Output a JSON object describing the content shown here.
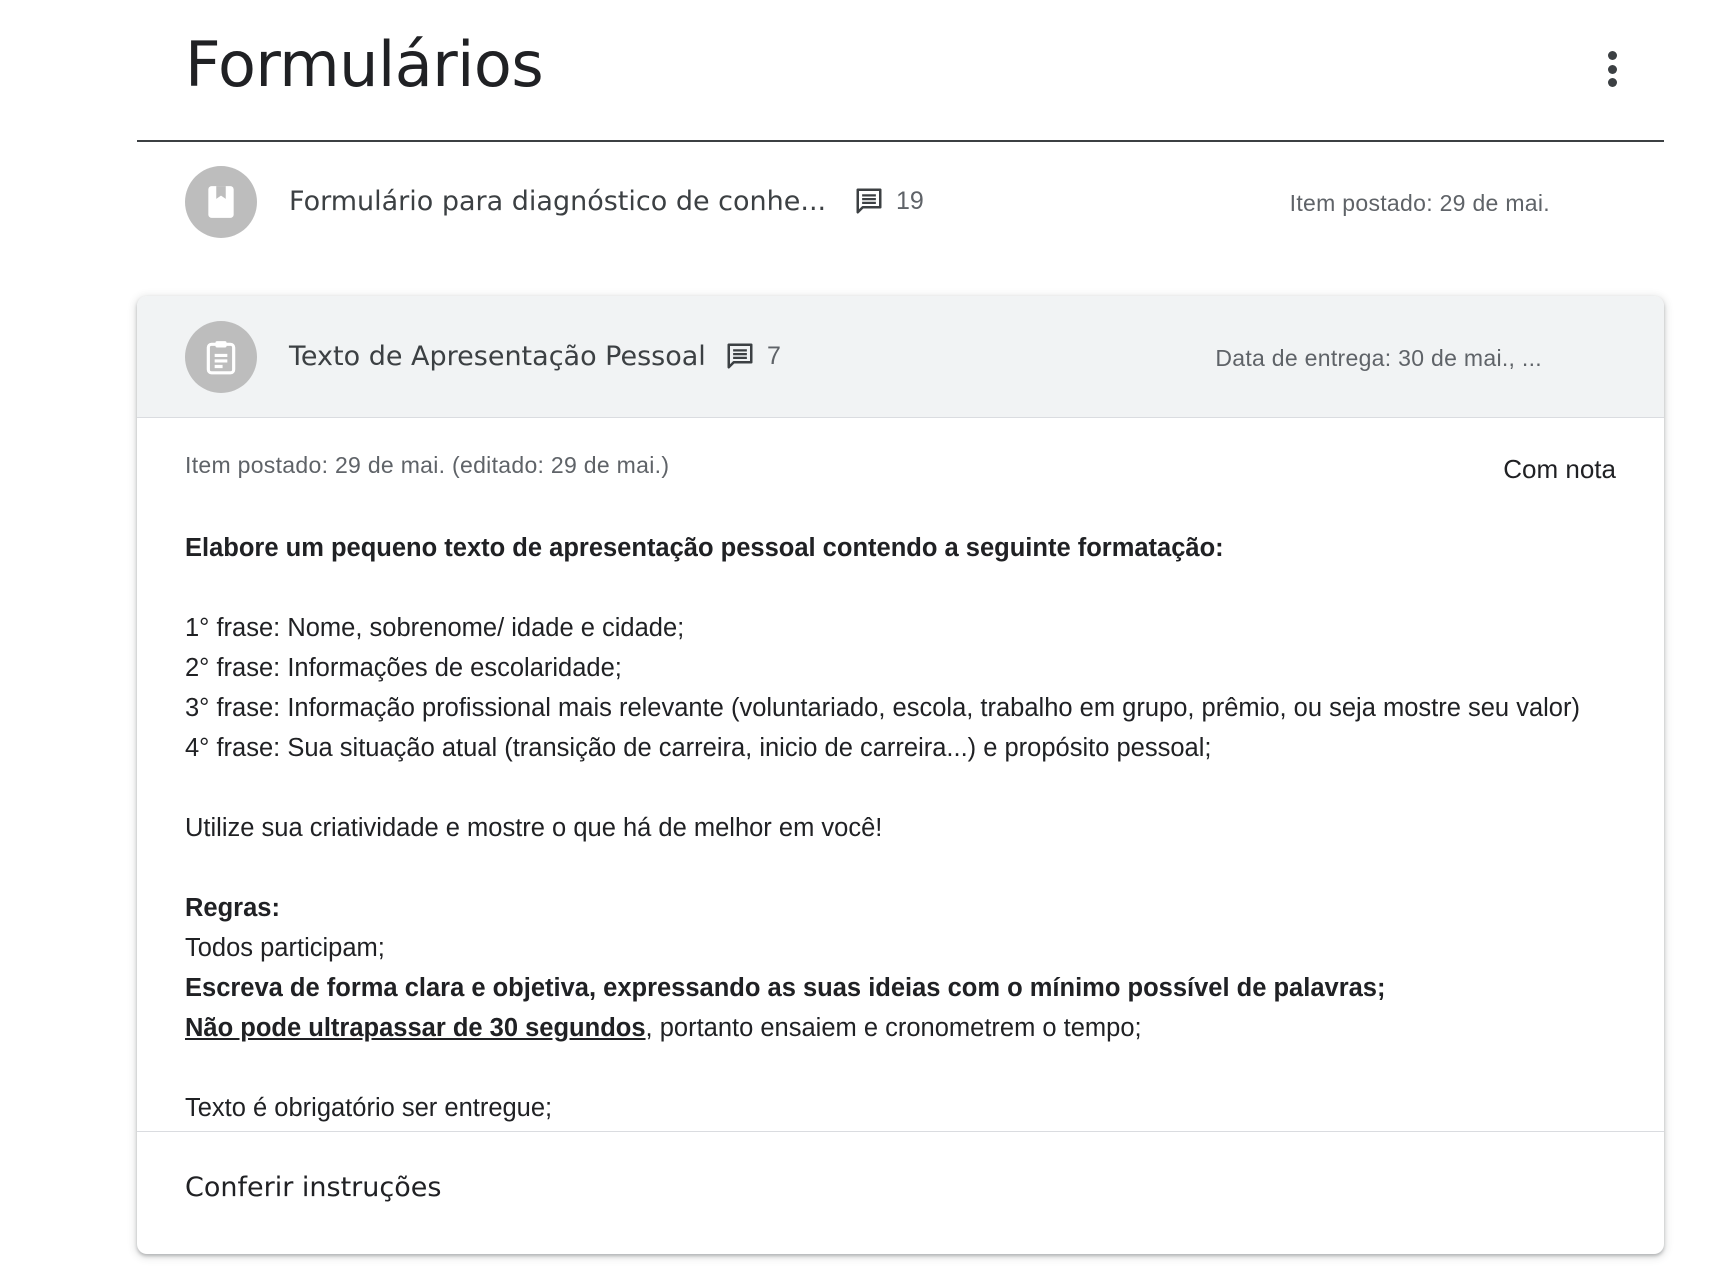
{
  "topic": {
    "title": "Formulários",
    "menu_icon": "more-vert-icon"
  },
  "items": [
    {
      "icon": "book-icon",
      "title": "Formulário para diagnóstico de conhe...",
      "comment_icon": "comment-icon",
      "comments": "19",
      "meta": "Item postado: 29 de mai."
    },
    {
      "icon": "assignment-icon",
      "title": "Texto de Apresentação Pessoal",
      "comment_icon": "comment-icon",
      "comments": "7",
      "meta": "Data de entrega: 30 de mai., ..."
    }
  ],
  "details": {
    "posted": "Item postado: 29 de mai. (editado: 29 de mai.)",
    "grading": "Com nota",
    "intro": "Elabore um pequeno texto de apresentação pessoal contendo a seguinte formatação:",
    "lines": [
      "1° frase: Nome, sobrenome/ idade e cidade;",
      "2° frase: Informações de escolaridade;",
      "3° frase: Informação profissional mais relevante (voluntariado, escola, trabalho em grupo, prêmio, ou seja mostre seu valor)",
      "4° frase: Sua situação atual (transição de carreira, inicio de carreira...)  e propósito pessoal;"
    ],
    "encourage": "Utilize sua criatividade e mostre o que há de melhor em você!",
    "rules_heading": "Regras:",
    "rule1": "Todos participam;",
    "rule2": "Escreva de forma clara e objetiva, expressando as suas ideias com o mínimo possível de palavras;",
    "rule3_underlined": "Não pode ultrapassar de 30 segundos",
    "rule3_rest": ", portanto ensaiem e cronometrem o tempo;",
    "mandatory": "Texto é obrigatório ser entregue;",
    "view_instructions": "Conferir instruções"
  }
}
